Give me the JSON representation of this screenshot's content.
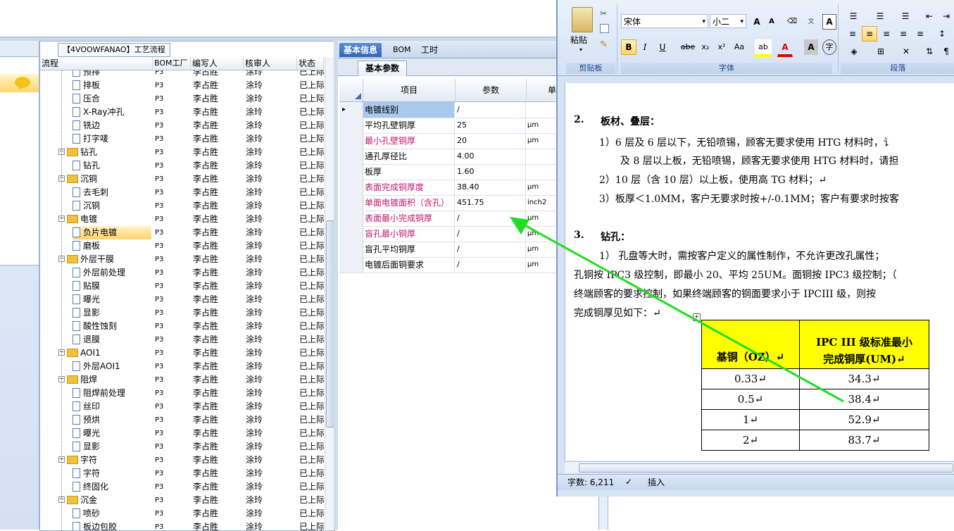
{
  "tree": {
    "title": "【4VOOWFANAO】工艺流程",
    "headers": [
      "流程",
      "BOM工厂",
      "编写人",
      "核审人",
      "状态"
    ],
    "rows": [
      {
        "name": "预排",
        "level": 2,
        "kind": "doc",
        "bom": "P3",
        "writer": "李占胜",
        "reviewer": "涂玲",
        "status": "已上际"
      },
      {
        "name": "排板",
        "level": 2,
        "kind": "doc",
        "bom": "P3",
        "writer": "李占胜",
        "reviewer": "涂玲",
        "status": "已上际"
      },
      {
        "name": "压合",
        "level": 2,
        "kind": "doc",
        "bom": "P3",
        "writer": "李占胜",
        "reviewer": "涂玲",
        "status": "已上际"
      },
      {
        "name": "X-Ray冲孔",
        "level": 2,
        "kind": "doc",
        "bom": "P3",
        "writer": "李占胜",
        "reviewer": "涂玲",
        "status": "已上际"
      },
      {
        "name": "铣边",
        "level": 2,
        "kind": "doc",
        "bom": "P3",
        "writer": "李占胜",
        "reviewer": "涂玲",
        "status": "已上际"
      },
      {
        "name": "打字唛",
        "level": 2,
        "kind": "doc",
        "bom": "P3",
        "writer": "李占胜",
        "reviewer": "涂玲",
        "status": "已上际"
      },
      {
        "name": "钻孔",
        "level": 1,
        "kind": "folder",
        "bom": "P3",
        "writer": "李占胜",
        "reviewer": "涂玲",
        "status": "已上际"
      },
      {
        "name": "钻孔",
        "level": 2,
        "kind": "doc",
        "bom": "P3",
        "writer": "李占胜",
        "reviewer": "涂玲",
        "status": "已上际"
      },
      {
        "name": "沉铜",
        "level": 1,
        "kind": "folder",
        "bom": "P3",
        "writer": "李占胜",
        "reviewer": "涂玲",
        "status": "已上际"
      },
      {
        "name": "去毛刺",
        "level": 2,
        "kind": "doc",
        "bom": "P3",
        "writer": "李占胜",
        "reviewer": "涂玲",
        "status": "已上际"
      },
      {
        "name": "沉铜",
        "level": 2,
        "kind": "doc",
        "bom": "P3",
        "writer": "李占胜",
        "reviewer": "涂玲",
        "status": "已上际"
      },
      {
        "name": "电镀",
        "level": 1,
        "kind": "folder",
        "bom": "P3",
        "writer": "李占胜",
        "reviewer": "涂玲",
        "status": "已上际"
      },
      {
        "name": "负片电镀",
        "level": 2,
        "kind": "doc",
        "bom": "P3",
        "writer": "李占胜",
        "reviewer": "涂玲",
        "status": "已上际",
        "selected": true
      },
      {
        "name": "磨板",
        "level": 2,
        "kind": "doc",
        "bom": "P3",
        "writer": "李占胜",
        "reviewer": "涂玲",
        "status": "已上际"
      },
      {
        "name": "外层干膜",
        "level": 1,
        "kind": "folder",
        "bom": "P3",
        "writer": "李占胜",
        "reviewer": "涂玲",
        "status": "已上际"
      },
      {
        "name": "外层前处理",
        "level": 2,
        "kind": "doc",
        "bom": "P3",
        "writer": "李占胜",
        "reviewer": "涂玲",
        "status": "已上际"
      },
      {
        "name": "贴膜",
        "level": 2,
        "kind": "doc",
        "bom": "P3",
        "writer": "李占胜",
        "reviewer": "涂玲",
        "status": "已上际"
      },
      {
        "name": "曝光",
        "level": 2,
        "kind": "doc",
        "bom": "P3",
        "writer": "李占胜",
        "reviewer": "涂玲",
        "status": "已上际"
      },
      {
        "name": "显影",
        "level": 2,
        "kind": "doc",
        "bom": "P3",
        "writer": "李占胜",
        "reviewer": "涂玲",
        "status": "已上际"
      },
      {
        "name": "酸性蚀刻",
        "level": 2,
        "kind": "doc",
        "bom": "P3",
        "writer": "李占胜",
        "reviewer": "涂玲",
        "status": "已上际"
      },
      {
        "name": "退膜",
        "level": 2,
        "kind": "doc",
        "bom": "P3",
        "writer": "李占胜",
        "reviewer": "涂玲",
        "status": "已上际"
      },
      {
        "name": "AOI1",
        "level": 1,
        "kind": "folder",
        "bom": "P3",
        "writer": "李占胜",
        "reviewer": "涂玲",
        "status": "已上际"
      },
      {
        "name": "外层AOI1",
        "level": 2,
        "kind": "doc",
        "bom": "P3",
        "writer": "李占胜",
        "reviewer": "涂玲",
        "status": "已上际"
      },
      {
        "name": "阻焊",
        "level": 1,
        "kind": "folder",
        "bom": "P3",
        "writer": "李占胜",
        "reviewer": "涂玲",
        "status": "已上际"
      },
      {
        "name": "阻焊前处理",
        "level": 2,
        "kind": "doc",
        "bom": "P3",
        "writer": "李占胜",
        "reviewer": "涂玲",
        "status": "已上际"
      },
      {
        "name": "丝印",
        "level": 2,
        "kind": "doc",
        "bom": "P3",
        "writer": "李占胜",
        "reviewer": "涂玲",
        "status": "已上际"
      },
      {
        "name": "预烘",
        "level": 2,
        "kind": "doc",
        "bom": "P3",
        "writer": "李占胜",
        "reviewer": "涂玲",
        "status": "已上际"
      },
      {
        "name": "曝光",
        "level": 2,
        "kind": "doc",
        "bom": "P3",
        "writer": "李占胜",
        "reviewer": "涂玲",
        "status": "已上际"
      },
      {
        "name": "显影",
        "level": 2,
        "kind": "doc",
        "bom": "P3",
        "writer": "李占胜",
        "reviewer": "涂玲",
        "status": "已上际"
      },
      {
        "name": "字符",
        "level": 1,
        "kind": "folder",
        "bom": "P3",
        "writer": "李占胜",
        "reviewer": "涂玲",
        "status": "已上际"
      },
      {
        "name": "字符",
        "level": 2,
        "kind": "doc",
        "bom": "P3",
        "writer": "李占胜",
        "reviewer": "涂玲",
        "status": "已上际"
      },
      {
        "name": "终固化",
        "level": 2,
        "kind": "doc",
        "bom": "P3",
        "writer": "李占胜",
        "reviewer": "涂玲",
        "status": "已上际"
      },
      {
        "name": "沉金",
        "level": 1,
        "kind": "folder",
        "bom": "P3",
        "writer": "李占胜",
        "reviewer": "涂玲",
        "status": "已上际"
      },
      {
        "name": "喷砂",
        "level": 2,
        "kind": "doc",
        "bom": "P3",
        "writer": "李占胜",
        "reviewer": "涂玲",
        "status": "已上际"
      },
      {
        "name": "板边包胶",
        "level": 2,
        "kind": "doc",
        "bom": "P3",
        "writer": "李占胜",
        "reviewer": "涂玲",
        "status": "已上际"
      }
    ]
  },
  "middle": {
    "tabs": [
      "基本信息",
      "BOM",
      "工时"
    ],
    "subtab": "基本参数",
    "grid_headers": [
      "项目",
      "参数",
      "单"
    ],
    "rows": [
      {
        "name": "电镀线别",
        "value": "/",
        "unit": "",
        "pink": false,
        "selected": true
      },
      {
        "name": "平均孔壁铜厚",
        "value": "25",
        "unit": "μm",
        "pink": false
      },
      {
        "name": "最小孔壁铜厚",
        "value": "20",
        "unit": "μm",
        "pink": true
      },
      {
        "name": "通孔厚径比",
        "value": "4.00",
        "unit": "",
        "pink": false
      },
      {
        "name": "板厚",
        "value": "1.60",
        "unit": "",
        "pink": false
      },
      {
        "name": "表面完成铜厚度",
        "value": "38.40",
        "unit": "μm",
        "pink": true
      },
      {
        "name": "单面电镀面积（含孔）",
        "value": "451.75",
        "unit": "inch2",
        "pink": true
      },
      {
        "name": "表面最小完成铜厚",
        "value": "/",
        "unit": "μm",
        "pink": true
      },
      {
        "name": "盲孔最小铜厚",
        "value": "/",
        "unit": "μm",
        "pink": true
      },
      {
        "name": "盲孔平均铜厚",
        "value": "/",
        "unit": "μm",
        "pink": false
      },
      {
        "name": "电镀后面铜要求",
        "value": "/",
        "unit": "μm",
        "pink": false
      }
    ]
  },
  "word": {
    "clipboard_group": "剪贴板",
    "paste_label": "粘贴",
    "font_group": "字体",
    "paragraph_group": "段落",
    "font_name": "宋体",
    "font_size": "小二",
    "font_buttons": [
      "B",
      "I",
      "U",
      "abe",
      "x₂",
      "x²",
      "Aa"
    ],
    "cut_text": "...",
    "doc": {
      "s2_num": "2.",
      "s2_title": "板材、叠层：",
      "s2_l1": "1）6 层及 6 层以下，无铅喷锡，顾客无要求使用 HTG 材料时，讠",
      "s2_l1b": "及 8 层以上板，无铅喷锡，顾客无要求使用 HTG 材料时，请担",
      "s2_l2": "2）10 层（含 10 层）以上板，使用高 TG 材料；↵",
      "s2_l3": "3）板厚＜1.0MM，客户无要求时按+/-0.1MM；客户有要求时按客",
      "s3_num": "3.",
      "s3_title": "钻孔：",
      "s3_l1": "1）  孔盘等大时，需按客户定义的属性制作，不允许更改孔属性；",
      "s3_l2": "孔铜按 IPC3 级控制，即最小 20、平均 25UM。面铜按 IPC3 级控制；（",
      "s3_l3": "终端顾客的要求控制，如果终端顾客的铜面要求小于 IPCIII 级，则按",
      "s3_l4": "完成铜厚见如下：↵",
      "table_h1": "基铜（OZ）↵",
      "table_h2a": "IPC III 级标准最小",
      "table_h2b": "完成铜厚(UM)↵",
      "table_rows": [
        [
          "0.33↵",
          "34.3↵"
        ],
        [
          "0.5↵",
          "38.4↵"
        ],
        [
          "1↵",
          "52.9↵"
        ],
        [
          "2↵",
          "83.7↵"
        ]
      ]
    },
    "status_words": "字数: 6,211",
    "status_insert": "插入"
  },
  "colors": {
    "arrow": "#22dd22",
    "pink_text": "#c0176f",
    "table_header_bg": "#ffff00"
  }
}
